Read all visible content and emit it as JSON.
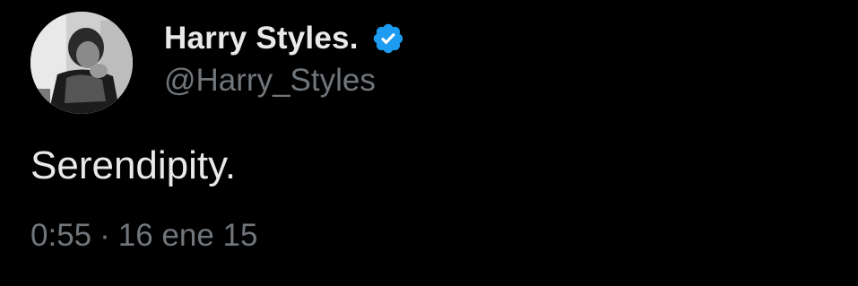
{
  "tweet": {
    "author": {
      "display_name": "Harry Styles.",
      "handle": "@Harry_Styles",
      "verified": true,
      "avatar_icon": "profile-photo"
    },
    "text": "Serendipity.",
    "time": "0:55",
    "separator": "·",
    "date": "16 ene 15"
  },
  "colors": {
    "background": "#000000",
    "primary_text": "#e7e9ea",
    "secondary_text": "#71767b",
    "verified_badge": "#1d9bf0"
  }
}
